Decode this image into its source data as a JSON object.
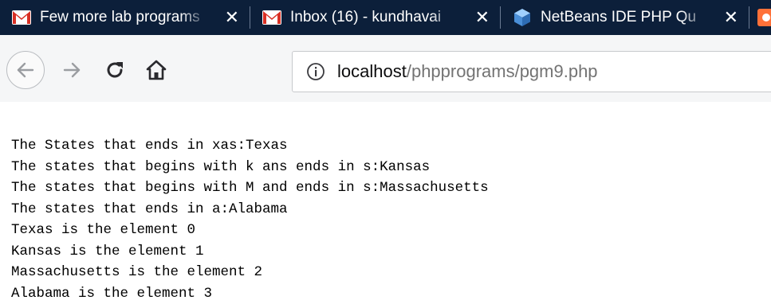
{
  "browser": {
    "tabs": [
      {
        "title": "Few more lab programs",
        "icon": "gmail-icon",
        "close": "✕"
      },
      {
        "title": "Inbox (16) - kundhavai",
        "icon": "gmail-icon",
        "close": "✕"
      },
      {
        "title": "NetBeans IDE PHP Qu",
        "icon": "netbeans-cube-icon",
        "close": "✕"
      },
      {
        "title": "",
        "icon": "orange-tab-icon",
        "close": ""
      }
    ],
    "address": {
      "host": "localhost",
      "path": "/phpprograms/pgm9.php",
      "info_icon": "info-icon"
    },
    "nav_icons": {
      "back": "back-arrow-icon",
      "forward": "forward-arrow-icon",
      "reload": "reload-icon",
      "home": "home-icon"
    }
  },
  "colors": {
    "tabstrip": "#0c1f3a",
    "gmail_red": "#d93025",
    "netbeans_blue": "#4a8fd8",
    "orange": "#ff7139"
  },
  "page": {
    "lines": [
      "The States that ends in xas:Texas",
      "The states that begins with k ans ends in s:Kansas",
      "The states that begins with M and ends in s:Massachusetts",
      "The states that ends in a:Alabama",
      "Texas is the element 0",
      "Kansas is the element 1",
      "Massachusetts is the element 2",
      "Alabama is the element 3"
    ]
  }
}
